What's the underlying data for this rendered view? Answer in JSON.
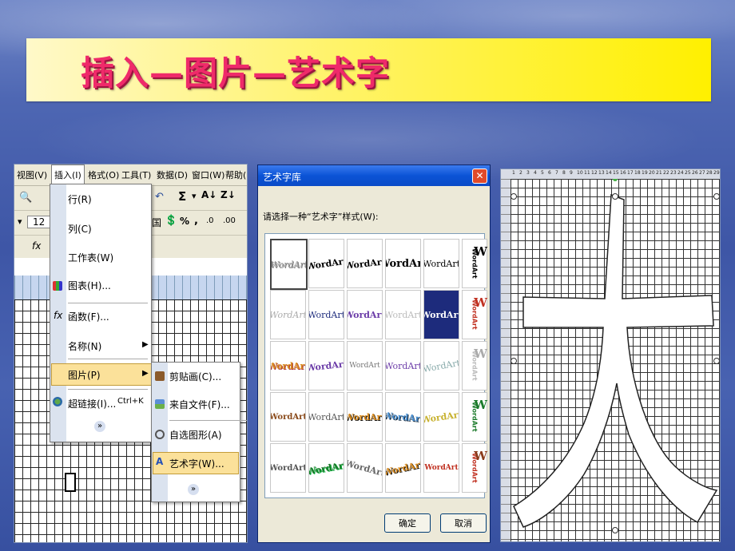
{
  "slide": {
    "title": "插入—图片—艺术字"
  },
  "excel": {
    "menubar": [
      "视图(V)",
      "插入(I)",
      "格式(O)",
      "工具(T)",
      "数据(D)",
      "窗口(W)",
      "帮助("
    ],
    "font_size": "12",
    "insert_menu": {
      "items": [
        {
          "label": "行(R)",
          "icon": "none"
        },
        {
          "label": "列(C)",
          "icon": "none"
        },
        {
          "label": "工作表(W)",
          "icon": "none"
        },
        {
          "label": "图表(H)...",
          "icon": "chart-icon"
        },
        {
          "label": "函数(F)...",
          "icon": "function-icon"
        },
        {
          "label": "名称(N)",
          "icon": "submenu-arrow-icon"
        },
        {
          "label": "图片(P)",
          "icon": "submenu-arrow-icon"
        },
        {
          "label": "超链接(I)...",
          "icon": "globe-icon",
          "shortcut": "Ctrl+K"
        }
      ],
      "more": "»"
    },
    "picture_submenu": {
      "items": [
        {
          "label": "剪贴画(C)...",
          "icon": "clipart-icon"
        },
        {
          "label": "来自文件(F)...",
          "icon": "image-file-icon"
        },
        {
          "label": "自选图形(A)",
          "icon": "autoshape-icon"
        },
        {
          "label": "艺术字(W)...",
          "icon": "wordart-icon"
        }
      ],
      "more": "»"
    }
  },
  "wordart_dialog": {
    "title": "艺术字库",
    "prompt": "请选择一种“艺术字”样式(W):",
    "sample_text": "WordArt",
    "vertical_sample": "WordArt",
    "w_sample": "W",
    "ok_label": "确定",
    "cancel_label": "取消",
    "colors": [
      "#000000",
      "#1d2b7c",
      "#6b3ca8",
      "#d98b1f",
      "#1b7a2a",
      "#c03020",
      "#4a8fd0",
      "#a3a3a3"
    ]
  },
  "worksheet_preview": {
    "character": "大",
    "ruler_numbers": [
      "1",
      "2",
      "3",
      "4",
      "5",
      "6",
      "7",
      "8",
      "9",
      "10",
      "11",
      "12",
      "13",
      "14",
      "15",
      "16",
      "17",
      "18",
      "19",
      "20",
      "21",
      "22",
      "23",
      "24",
      "25",
      "26",
      "27",
      "28",
      "29"
    ]
  }
}
